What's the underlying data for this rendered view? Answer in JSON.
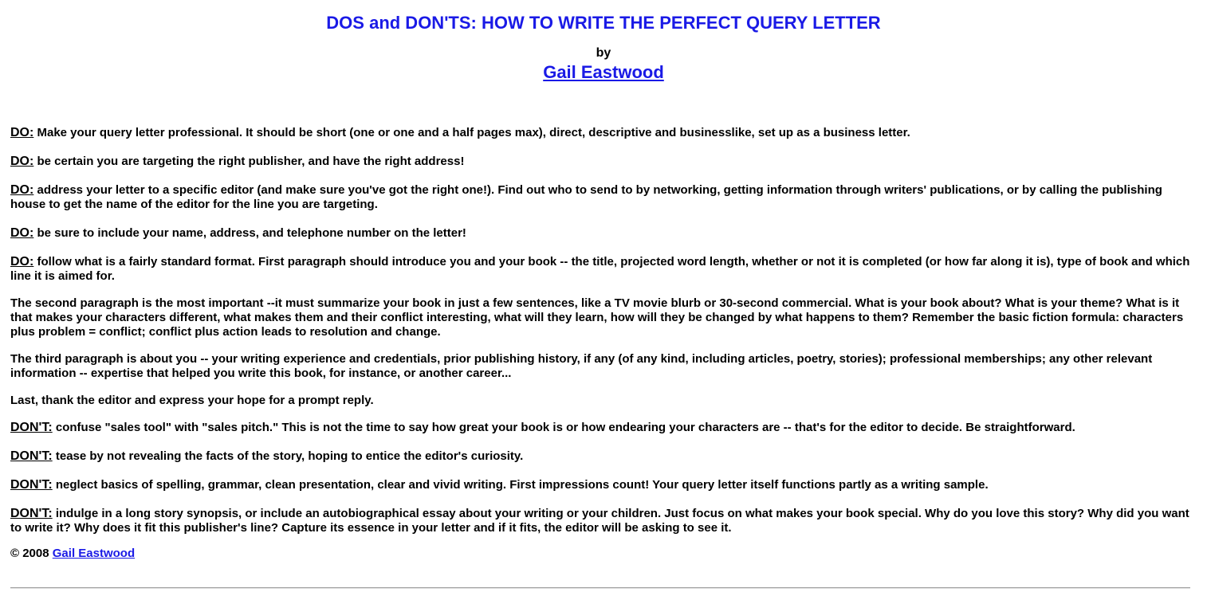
{
  "header": {
    "title": "DOS and DON'TS: HOW TO WRITE THE PERFECT QUERY LETTER",
    "by": "by",
    "author_link": "Gail Eastwood"
  },
  "paragraphs": [
    {
      "tag": "DO:",
      "text": " Make your query letter professional. It should be short (one or one and a half pages max), direct, descriptive and businesslike, set up as a business letter."
    },
    {
      "tag": "DO:",
      "text": " be certain you are targeting the right publisher, and have the right address!"
    },
    {
      "tag": "DO:",
      "text": " address your letter to a specific editor (and make sure you've got the right one!). Find out who to send to by networking, getting information through writers' publications, or by calling the publishing house to get the name of the editor for the line you are targeting."
    },
    {
      "tag": "DO:",
      "text": " be sure to include your name, address, and telephone number on the letter!"
    },
    {
      "tag": "DO:",
      "text": " follow what is a fairly standard format. First paragraph should introduce you and your book -- the title, projected word length, whether or not it is completed (or how far along it is), type of book and which line it is aimed for."
    },
    {
      "tag": "",
      "text": "The second paragraph is the most important --it must summarize your book in just a few sentences, like a TV movie blurb or 30-second commercial. What is your book about? What is your theme? What is it that makes your characters different, what makes them and their conflict interesting, what will they learn, how will they be changed by what happens to them? Remember the basic fiction formula: characters plus problem = conflict; conflict plus action leads to resolution and change."
    },
    {
      "tag": "",
      "text": "The third paragraph is about you -- your writing experience and credentials, prior publishing history, if any (of any kind, including articles, poetry, stories); professional memberships; any other relevant information -- expertise that helped you write this book, for instance, or another career..."
    },
    {
      "tag": "",
      "text": "Last, thank the editor and express your hope for a prompt reply."
    },
    {
      "tag": "DON'T:",
      "text": " confuse \"sales tool\" with \"sales pitch.\" This is not the time to say how great your book is or how endearing your characters are -- that's for the editor to decide. Be straightforward."
    },
    {
      "tag": "DON'T:",
      "text": " tease by not revealing the facts of the story, hoping to entice the editor's curiosity."
    },
    {
      "tag": "DON'T:",
      "text": " neglect basics of spelling, grammar, clean presentation, clear and vivid writing. First impressions count! Your query letter itself functions partly as a writing sample."
    },
    {
      "tag": "DON'T:",
      "text": " indulge in a long story synopsis, or include an autobiographical essay about your writing or your children. Just focus on what makes your book special. Why do you love this story? Why did you want to write it? Why does it fit this publisher's line? Capture its essence in your letter and if it fits, the editor will be asking to see it."
    }
  ],
  "footer": {
    "copyright": "© 2008 ",
    "link": "Gail Eastwood"
  },
  "colors": {
    "link": "#1a1ae6",
    "text": "#000000",
    "background": "#ffffff"
  }
}
